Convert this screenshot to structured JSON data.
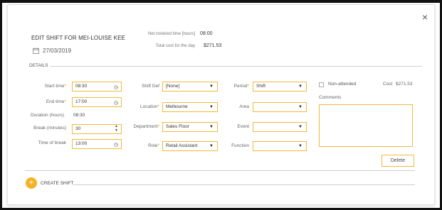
{
  "header": {
    "title": "EDIT SHIFT FOR MEI-LOUISE KEE",
    "date": "27/03/2019",
    "net_rostered_label": "Net rostered time [hours]",
    "net_rostered_value": "08:00",
    "total_cost_label": "Total cost for the day",
    "total_cost_value": "$271.53"
  },
  "close_icon": "×",
  "details": {
    "section_label": "DETAILS",
    "start_time": {
      "label": "Start time",
      "value": "08:30"
    },
    "end_time": {
      "label": "End time",
      "value": "17:00"
    },
    "duration": {
      "label": "Duration (hours)",
      "value": "08:30"
    },
    "break_minutes": {
      "label": "Break (minutes)",
      "value": "30"
    },
    "time_of_break": {
      "label": "Time of break",
      "value": "13:00"
    },
    "shift_def": {
      "label": "Shift Def",
      "value": "[None]"
    },
    "location": {
      "label": "Location",
      "value": "Melbourne"
    },
    "department": {
      "label": "Department",
      "value": "Sales Floor"
    },
    "role": {
      "label": "Role",
      "value": "Retail Assistant"
    },
    "period": {
      "label": "Period",
      "value": "Shift"
    },
    "area": {
      "label": "Area",
      "value": ""
    },
    "event": {
      "label": "Event",
      "value": ""
    },
    "function": {
      "label": "Function",
      "value": ""
    },
    "non_attended_label": "Non-attended",
    "cost_label": "Cost",
    "cost_value": "$271.53",
    "comments_label": "Comments",
    "comments_value": ""
  },
  "delete_label": "Delete",
  "create_shift_label": "CREATE SHIFT",
  "required_mark": "*",
  "colors": {
    "accent": "#f5b324",
    "field_border": "#f0b93a"
  },
  "icons": {
    "clock": "clock-icon",
    "calendar": "calendar-icon",
    "caret": "caret-down-icon",
    "spinner": "spinner-icon",
    "plus": "plus-icon"
  }
}
